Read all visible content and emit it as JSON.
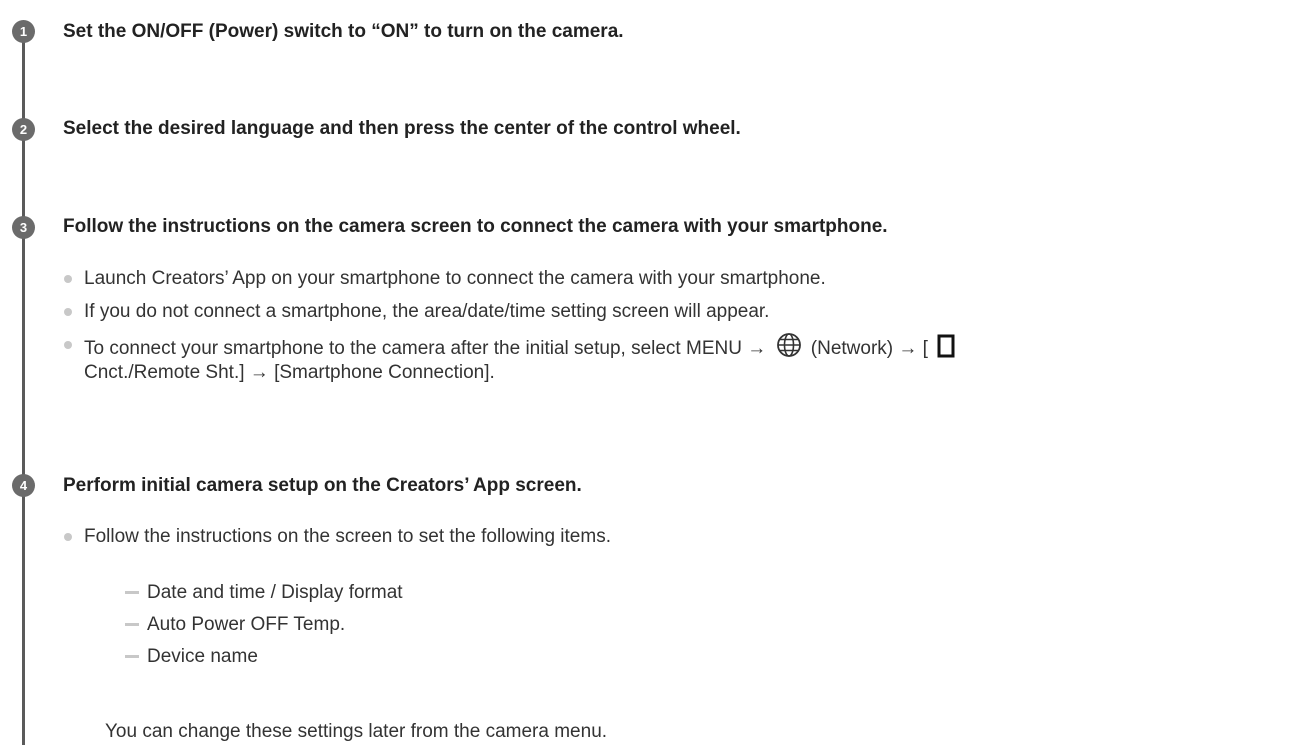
{
  "steps": [
    {
      "number": "1",
      "title": "Set the ON/OFF (Power) switch to “ON” to turn on the camera."
    },
    {
      "number": "2",
      "title": "Select the desired language and then press the center of the control wheel."
    },
    {
      "number": "3",
      "title": "Follow the instructions on the camera screen to connect the camera with your smartphone.",
      "bullets": [
        "Launch Creators’ App on your smartphone to connect the camera with your smartphone.",
        "If you do not connect a smartphone, the area/date/time setting screen will appear."
      ],
      "bullet3": {
        "before_network": "To connect your smartphone to the camera after the initial setup, select MENU →",
        "network_label": "(Network) → [",
        "line2": "Cnct./Remote Sht.] → [Smartphone Connection]."
      }
    },
    {
      "number": "4",
      "title": "Perform initial camera setup on the Creators’ App screen.",
      "bullets": [
        "Follow the instructions on the screen to set the following items."
      ],
      "subitems": [
        "Date and time / Display format",
        "Auto Power OFF Temp.",
        "Device name"
      ],
      "note": "You can change these settings later from the camera menu."
    }
  ],
  "icons": {
    "step_badge_color": "#6b6b6b",
    "bullet_color": "#c8c8c8",
    "network_icon": "globe-icon",
    "device_icon": "rectangle-icon"
  }
}
